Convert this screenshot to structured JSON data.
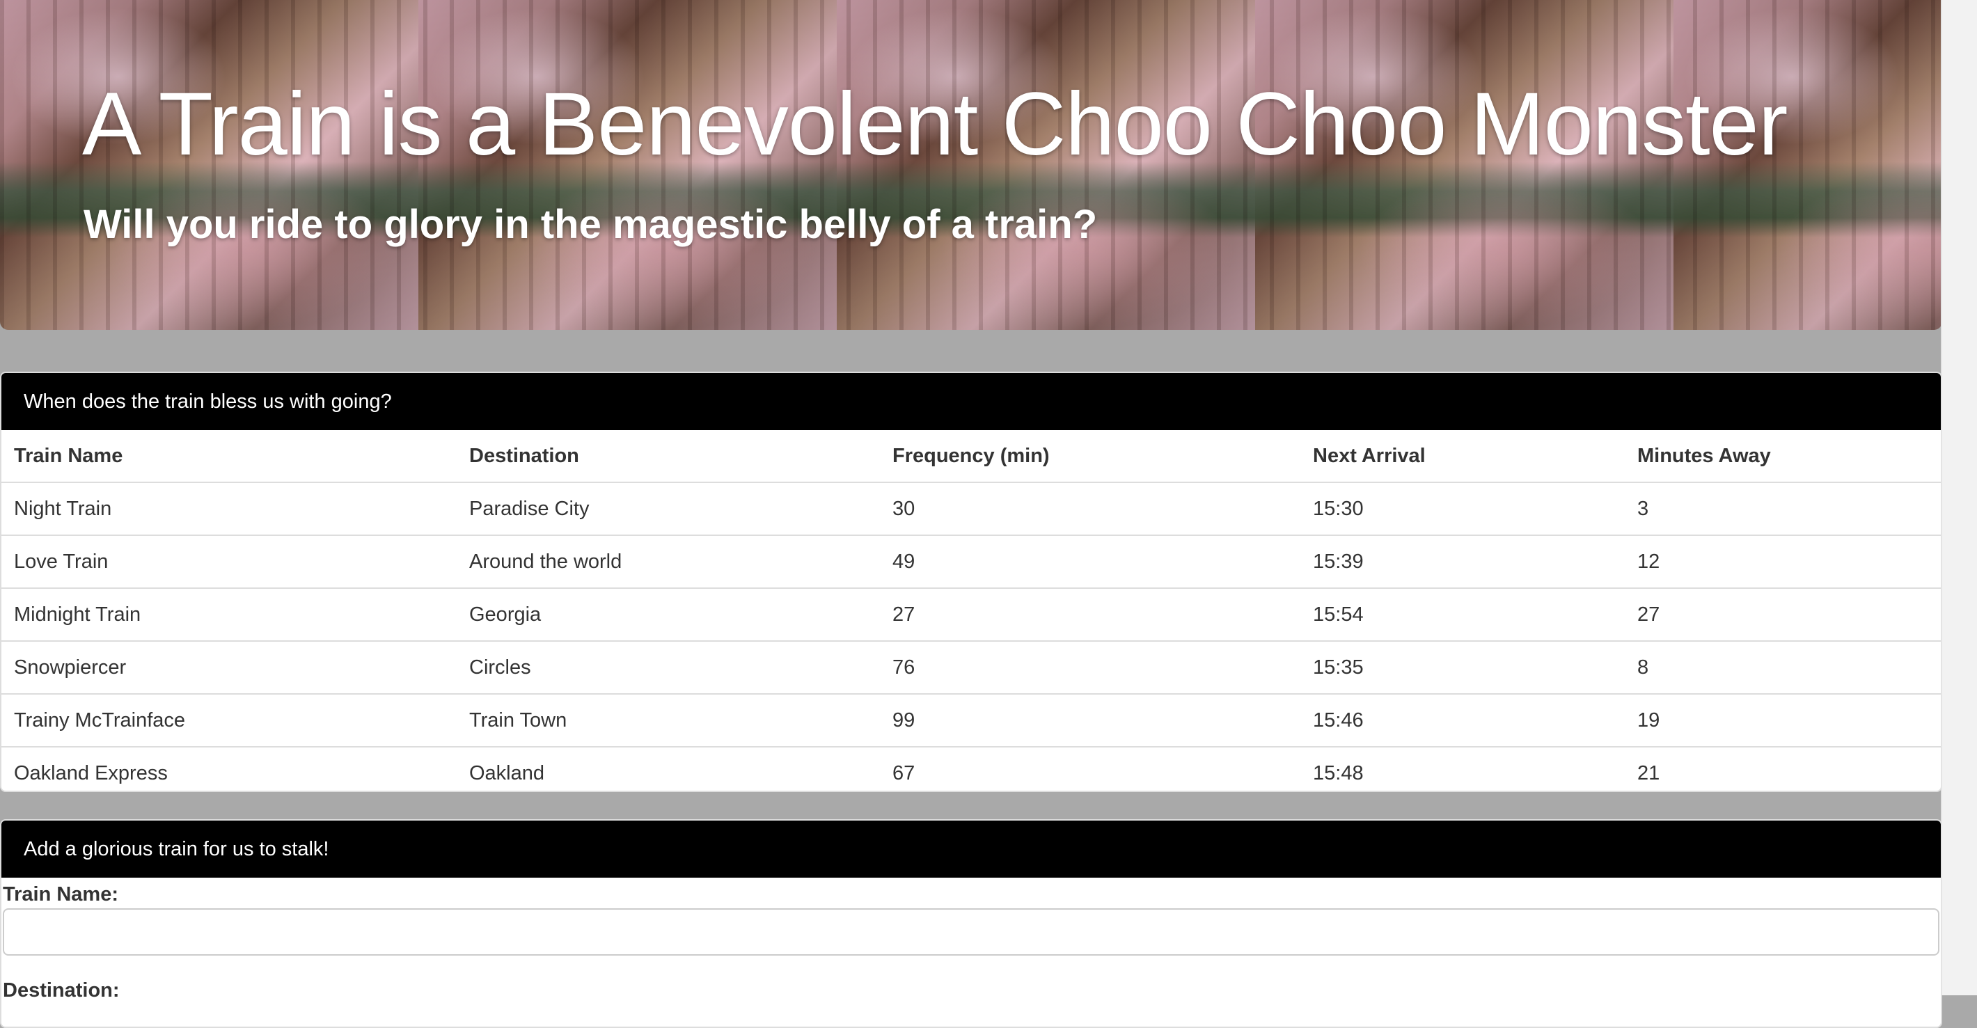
{
  "hero": {
    "title": "A Train is a Benevolent Choo Choo Monster",
    "subtitle": "Will you ride to glory in the magestic belly of a train?"
  },
  "schedule": {
    "heading": "When does the train bless us with going?",
    "columns": [
      "Train Name",
      "Destination",
      "Frequency (min)",
      "Next Arrival",
      "Minutes Away"
    ],
    "rows": [
      [
        "Night Train",
        "Paradise City",
        "30",
        "15:30",
        "3"
      ],
      [
        "Love Train",
        "Around the world",
        "49",
        "15:39",
        "12"
      ],
      [
        "Midnight Train",
        "Georgia",
        "27",
        "15:54",
        "27"
      ],
      [
        "Snowpiercer",
        "Circles",
        "76",
        "15:35",
        "8"
      ],
      [
        "Trainy McTrainface",
        "Train Town",
        "99",
        "15:46",
        "19"
      ],
      [
        "Oakland Express",
        "Oakland",
        "67",
        "15:48",
        "21"
      ]
    ]
  },
  "add_train": {
    "heading": "Add a glorious train for us to stalk!",
    "train_name_label": "Train Name:",
    "train_name_value": "",
    "destination_label": "Destination:"
  },
  "colors": {
    "page_background": "#a9a9a9",
    "panel_heading": "#000000",
    "text": "#333333"
  }
}
